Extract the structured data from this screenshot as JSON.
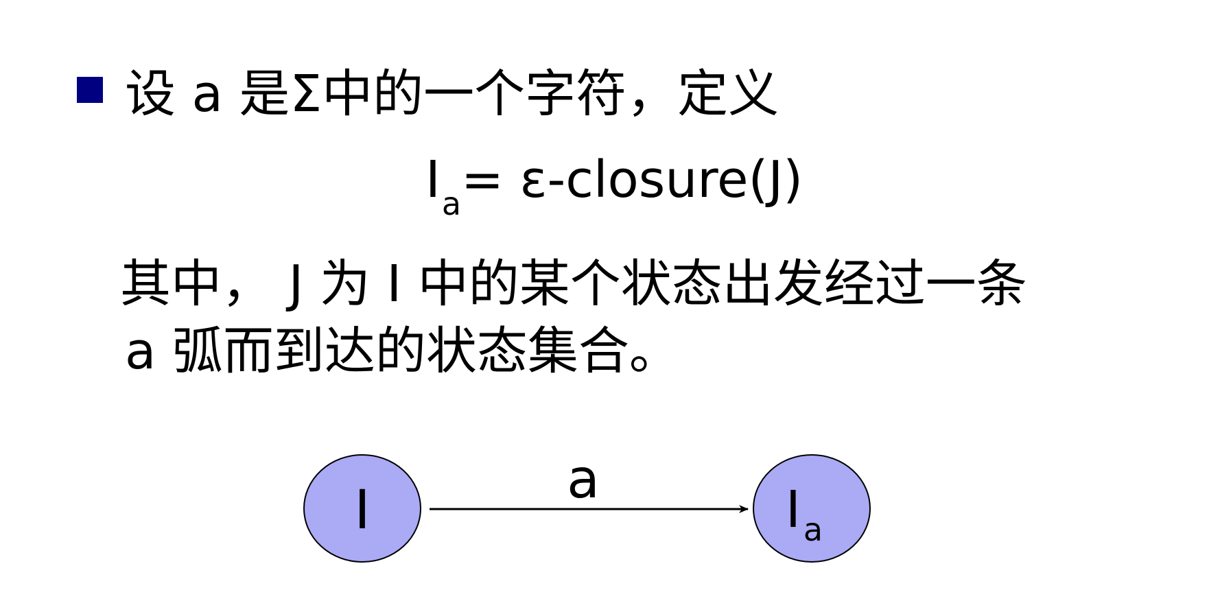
{
  "text": {
    "line1": "设 a 是Σ中的一个字符，定义",
    "formula_lhs": "I",
    "formula_sub": "a",
    "formula_rhs": "= ε-closure(J)",
    "line3": "其中， J 为 I 中的某个状态出发经过一条",
    "line4": "a 弧而到达的状态集合。"
  },
  "diagram": {
    "node_from": "I",
    "node_to": "I",
    "node_to_sub": "a",
    "edge_label": "a"
  },
  "colors": {
    "bullet": "#000080",
    "node_fill": "#aaaaf5",
    "stroke": "#000000"
  }
}
